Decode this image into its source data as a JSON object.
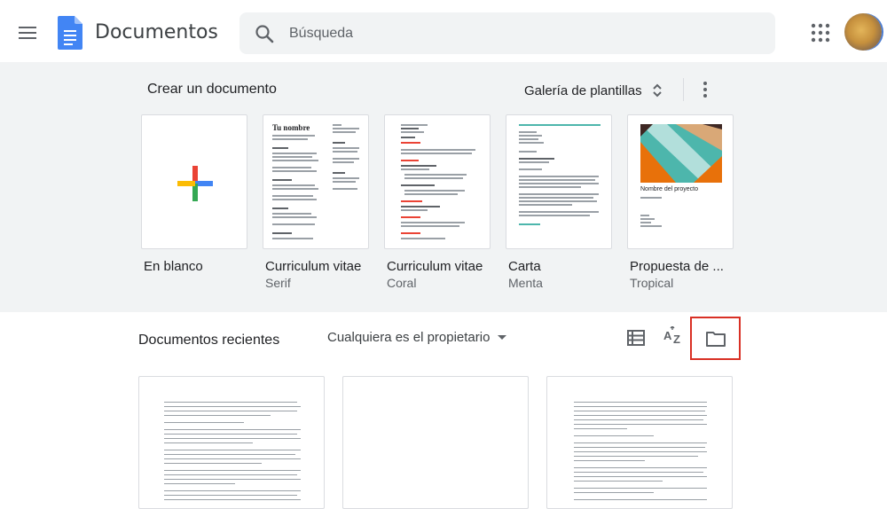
{
  "header": {
    "app_title": "Documentos",
    "search_placeholder": "Búsqueda"
  },
  "templates": {
    "title": "Crear un documento",
    "gallery_label": "Galería de plantillas",
    "items": [
      {
        "name": "En blanco",
        "subtitle": ""
      },
      {
        "name": "Curriculum vitae",
        "subtitle": "Serif",
        "thumb_heading": "Tu nombre"
      },
      {
        "name": "Curriculum vitae",
        "subtitle": "Coral"
      },
      {
        "name": "Carta",
        "subtitle": "Menta"
      },
      {
        "name": "Propuesta de ...",
        "subtitle": "Tropical",
        "thumb_heading": "Nombre del proyecto"
      }
    ]
  },
  "recent": {
    "title": "Documentos recientes",
    "owner_filter": "Cualquiera es el propietario"
  },
  "colors": {
    "docs_blue": "#4285f4",
    "plus_red": "#ea4335",
    "plus_yellow": "#fbbc04",
    "plus_green": "#34a853",
    "tropical_teal": "#4db6ac",
    "tropical_orange": "#e8710a",
    "highlight_red": "#d93025"
  },
  "icons": [
    "menu-icon",
    "docs-logo-icon",
    "search-icon",
    "apps-grid-icon",
    "sort-arrows-icon",
    "more-vert-icon",
    "list-view-icon",
    "sort-az-icon",
    "folder-icon",
    "dropdown-arrow-icon"
  ]
}
